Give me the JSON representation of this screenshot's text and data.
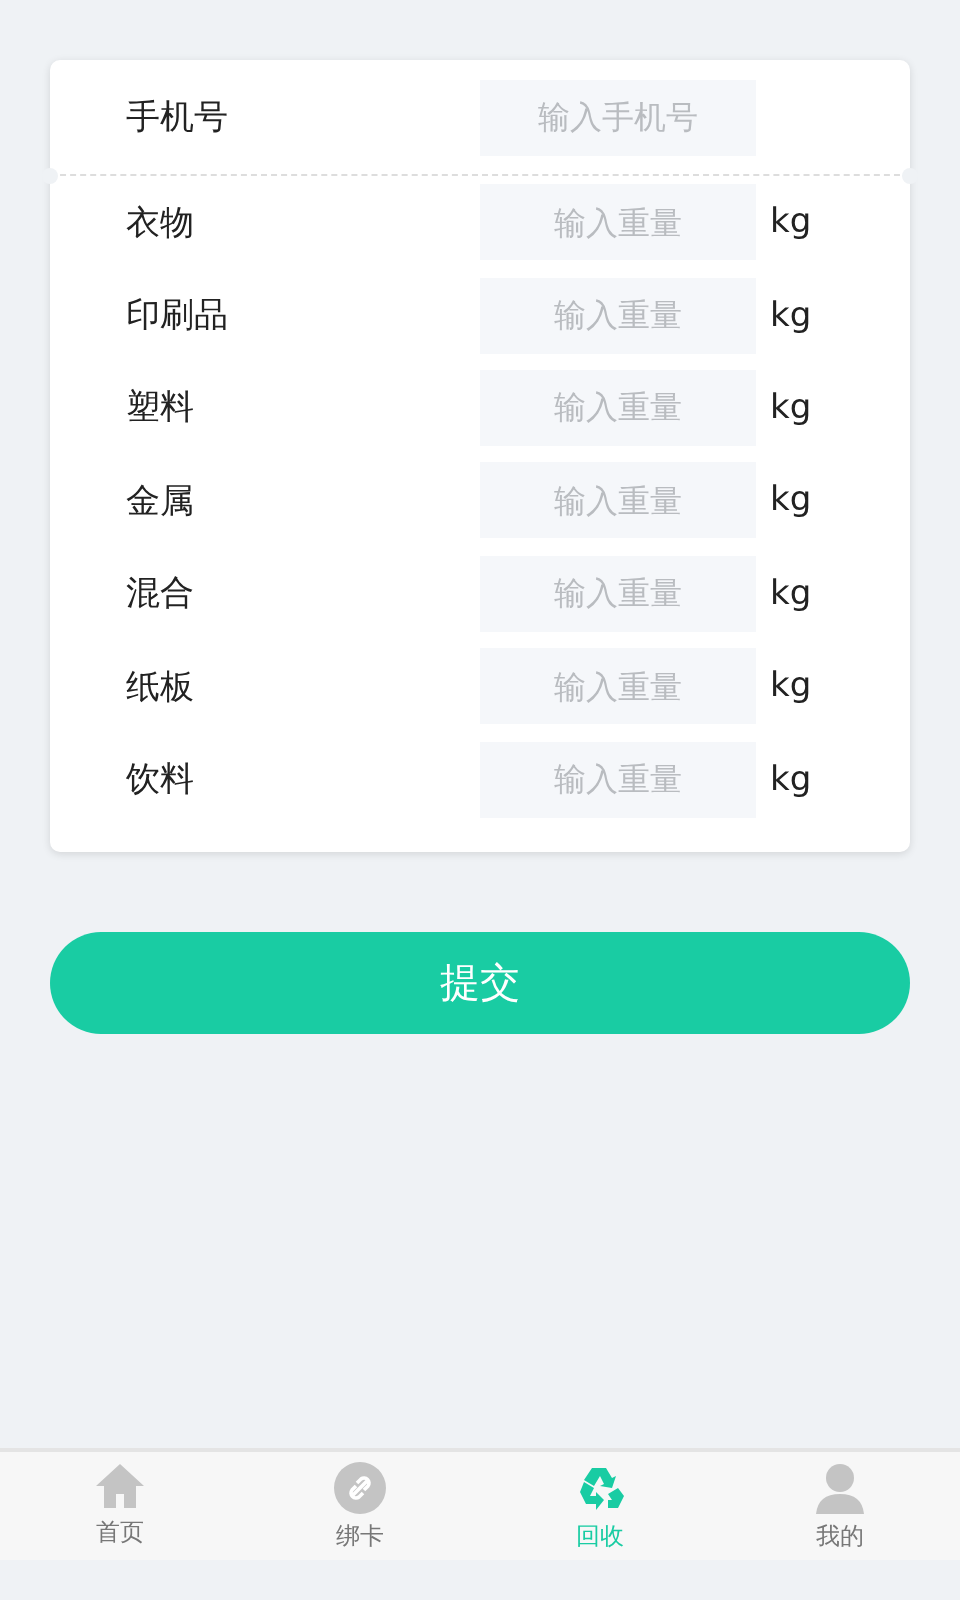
{
  "phone": {
    "label": "手机号",
    "placeholder": "输入手机号"
  },
  "items": [
    {
      "label": "衣物",
      "placeholder": "输入重量",
      "unit": "kg"
    },
    {
      "label": "印刷品",
      "placeholder": "输入重量",
      "unit": "kg"
    },
    {
      "label": "塑料",
      "placeholder": "输入重量",
      "unit": "kg"
    },
    {
      "label": "金属",
      "placeholder": "输入重量",
      "unit": "kg"
    },
    {
      "label": "混合",
      "placeholder": "输入重量",
      "unit": "kg"
    },
    {
      "label": "纸板",
      "placeholder": "输入重量",
      "unit": "kg"
    },
    {
      "label": "饮料",
      "placeholder": "输入重量",
      "unit": "kg"
    }
  ],
  "submit": "提交",
  "tabs": [
    {
      "kind": "home",
      "label": "首页",
      "selected": false
    },
    {
      "kind": "link",
      "label": "绑卡",
      "selected": false
    },
    {
      "kind": "recycle",
      "label": "回收",
      "selected": true
    },
    {
      "kind": "user",
      "label": "我的",
      "selected": false
    }
  ]
}
